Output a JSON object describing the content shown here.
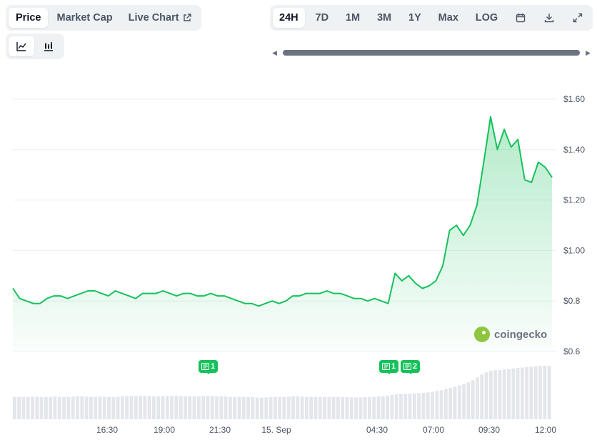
{
  "tabs": [
    {
      "label": "Price",
      "active": true
    },
    {
      "label": "Market Cap",
      "active": false
    },
    {
      "label": "Live Chart",
      "active": false,
      "icon": "external-link-icon"
    }
  ],
  "chart_types": [
    {
      "icon": "line-chart-icon",
      "active": true
    },
    {
      "icon": "candlestick-chart-icon",
      "active": false
    }
  ],
  "ranges": [
    {
      "label": "24H",
      "active": true
    },
    {
      "label": "7D",
      "active": false
    },
    {
      "label": "1M",
      "active": false
    },
    {
      "label": "3M",
      "active": false
    },
    {
      "label": "1Y",
      "active": false
    },
    {
      "label": "Max",
      "active": false
    },
    {
      "label": "LOG",
      "active": false
    }
  ],
  "range_icons": [
    "calendar-icon",
    "download-icon",
    "fullscreen-icon"
  ],
  "watermark": "coingecko",
  "events": [
    {
      "label": "1",
      "x": "19:45"
    },
    {
      "label": "1",
      "x": "05:00"
    },
    {
      "label": "2",
      "x": "05:30"
    }
  ],
  "colors": {
    "line": "#16c15b",
    "badge": "#16c15b",
    "volume": "#e3e6ea",
    "active_tab_bg": "#ffffff"
  },
  "chart_data": {
    "type": "area",
    "y_unit": "USD",
    "ylim": [
      0.6,
      1.6
    ],
    "y_ticks": [
      "$1.60",
      "$1.40",
      "$1.20",
      "$1.00",
      "$0.8",
      "$0.6"
    ],
    "y_tick_values": [
      1.6,
      1.4,
      1.2,
      1.0,
      0.8,
      0.6
    ],
    "x_ticks": [
      "16:30",
      "19:00",
      "21:30",
      "15. Sep",
      "04:30",
      "07:00",
      "09:30",
      "12:00"
    ],
    "grid": true,
    "series": [
      {
        "values": [
          0.85,
          0.81,
          0.8,
          0.79,
          0.79,
          0.81,
          0.82,
          0.82,
          0.81,
          0.82,
          0.83,
          0.84,
          0.84,
          0.83,
          0.82,
          0.84,
          0.83,
          0.82,
          0.81,
          0.83,
          0.83,
          0.83,
          0.84,
          0.83,
          0.82,
          0.83,
          0.83,
          0.82,
          0.82,
          0.83,
          0.82,
          0.82,
          0.81,
          0.8,
          0.79,
          0.79,
          0.78,
          0.79,
          0.8,
          0.79,
          0.8,
          0.82,
          0.82,
          0.83,
          0.83,
          0.83,
          0.84,
          0.83,
          0.83,
          0.82,
          0.81,
          0.81,
          0.8,
          0.81,
          0.8,
          0.79,
          0.91,
          0.88,
          0.9,
          0.87,
          0.85,
          0.86,
          0.88,
          0.94,
          1.08,
          1.1,
          1.06,
          1.1,
          1.18,
          1.35,
          1.53,
          1.4,
          1.48,
          1.41,
          1.44,
          1.28,
          1.27,
          1.35,
          1.33,
          1.29
        ],
        "volume": [
          0.4,
          0.4,
          0.4,
          0.41,
          0.4,
          0.4,
          0.41,
          0.4,
          0.4,
          0.41,
          0.41,
          0.4,
          0.4,
          0.41,
          0.4,
          0.4,
          0.41,
          0.42,
          0.41,
          0.42,
          0.42,
          0.41,
          0.41,
          0.42,
          0.42,
          0.41,
          0.41,
          0.41,
          0.42,
          0.42,
          0.41,
          0.41,
          0.4,
          0.4,
          0.4,
          0.4,
          0.39,
          0.39,
          0.4,
          0.4,
          0.4,
          0.41,
          0.41,
          0.4,
          0.4,
          0.4,
          0.4,
          0.4,
          0.4,
          0.4,
          0.39,
          0.39,
          0.4,
          0.4,
          0.41,
          0.42,
          0.44,
          0.45,
          0.46,
          0.46,
          0.47,
          0.48,
          0.5,
          0.52,
          0.55,
          0.58,
          0.62,
          0.66,
          0.72,
          0.8,
          0.86,
          0.88,
          0.89,
          0.9,
          0.92,
          0.93,
          0.94,
          0.95,
          0.96,
          0.96
        ]
      }
    ]
  }
}
